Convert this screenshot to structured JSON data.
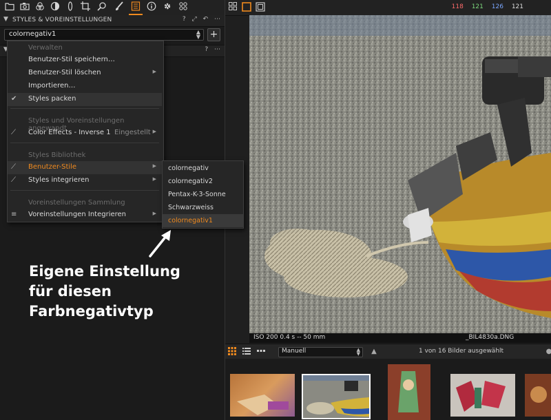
{
  "toolbar": {
    "tools": [
      "folder-icon",
      "camera-icon",
      "color-circles-icon",
      "lens-icon",
      "crop-icon",
      "search-icon",
      "brush-icon",
      "styles-list-icon",
      "info-icon",
      "gear-icon",
      "presets-icon"
    ],
    "active_tool": "styles-list-icon"
  },
  "styles_panel": {
    "title": "STYLES & VOREINSTELLUNGEN",
    "header_icons": [
      "?",
      "⤢",
      "↶",
      "⋯"
    ],
    "selected_style": "colornegativ1",
    "add_label": "+"
  },
  "menu": {
    "verwalten": "Verwalten",
    "save_style": "Benutzer-Stil speichern…",
    "delete_style": "Benutzer-Stil löschen",
    "import": "Importieren…",
    "pack_styles": "Styles packen",
    "applied_header": "Styles und Voreinstellungen angewandt",
    "applied_item": "Color Effects - Inverse 1",
    "applied_note": "Eingestellt",
    "library_header": "Styles Bibliothek",
    "user_styles": "Benutzer-Stile",
    "integrated_styles": "Styles integrieren",
    "presets_header": "Voreinstellungen Sammlung",
    "presets_integrated": "Voreinstellungen Integrieren"
  },
  "submenu": {
    "items": [
      "colornegativ",
      "colornegativ2",
      "Pentax-K-3-Sonne",
      "Schwarzweiss",
      "colornegativ1"
    ],
    "selected": "colornegativ1"
  },
  "annotation": {
    "line1": "Eigene Einstellung",
    "line2": "für diesen",
    "line3": "Farbnegativtyp"
  },
  "viewer": {
    "rgb": [
      "118",
      "121",
      "126",
      "121"
    ],
    "rgb_colors": [
      "#ff6b6b",
      "#7dd87d",
      "#7ba7ff",
      "#dddddd"
    ],
    "info_left": "ISO 200  0.4 s  --  50 mm",
    "filename": "_BIL4830a.DNG"
  },
  "browser": {
    "sort": "Manuell",
    "selection_text": "1 von 16 Bilder ausgewählt",
    "thumb_count": 5
  },
  "colors": {
    "accent": "#f08a1e",
    "panel_bg": "#1b1b1b"
  }
}
